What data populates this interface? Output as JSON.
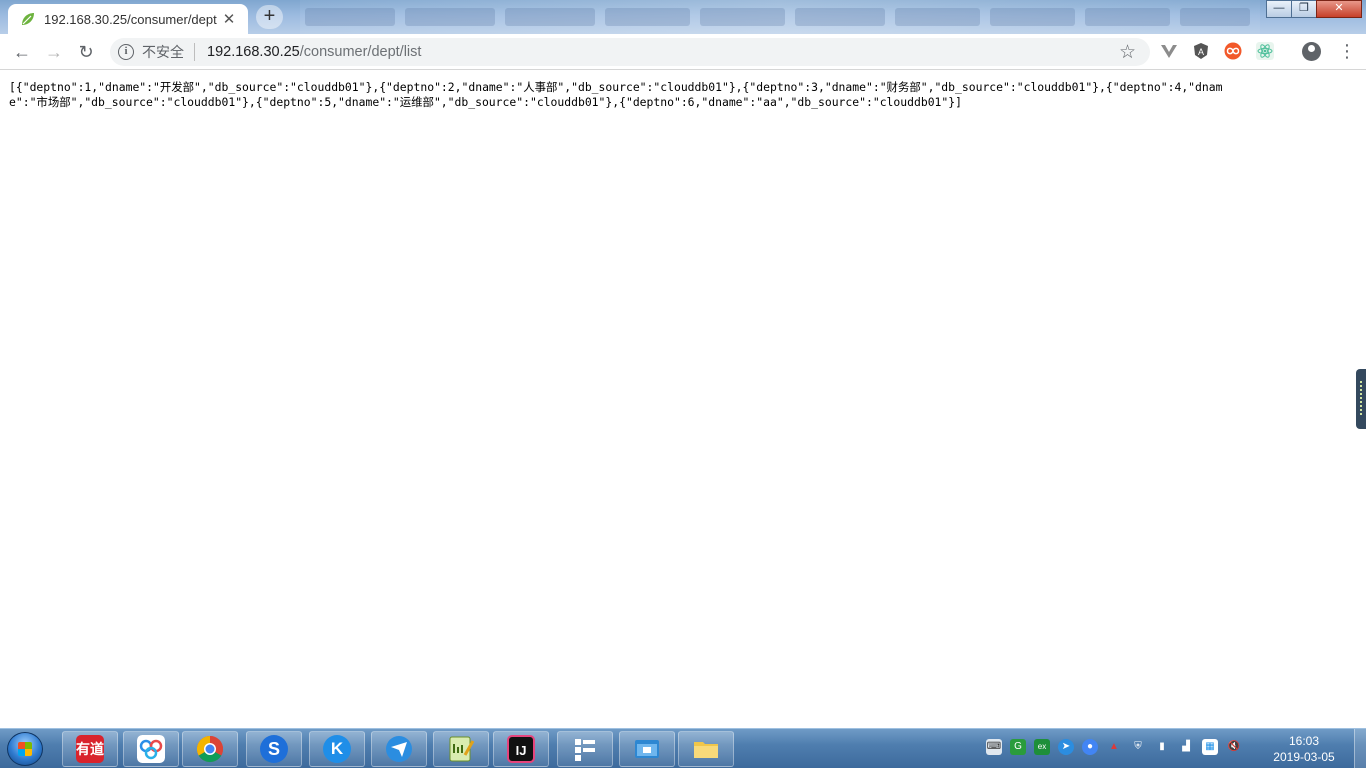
{
  "browser": {
    "tab": {
      "title": "192.168.30.25/consumer/dept",
      "close": "✕",
      "favicon": "spring-leaf-icon"
    },
    "new_tab": "+",
    "window_controls": {
      "minimize": "—",
      "maximize": "❐",
      "close": "✕"
    },
    "toolbar": {
      "back": "←",
      "forward": "→",
      "reload": "↻",
      "security_icon": "i",
      "security_label": "不安全",
      "url_host": "192.168.30.25",
      "url_path": "/consumer/dept/list",
      "bookmark": "☆",
      "menu": "⋮"
    },
    "extensions": [
      "vue-devtools-icon",
      "adblock-icon",
      "infinity-icon",
      "react-devtools-icon",
      "profile-icon"
    ]
  },
  "page": {
    "json_text": "[{\"deptno\":1,\"dname\":\"开发部\",\"db_source\":\"clouddb01\"},{\"deptno\":2,\"dname\":\"人事部\",\"db_source\":\"clouddb01\"},{\"deptno\":3,\"dname\":\"财务部\",\"db_source\":\"clouddb01\"},{\"deptno\":4,\"dname\":\"市场部\",\"db_source\":\"clouddb01\"},{\"deptno\":5,\"dname\":\"运维部\",\"db_source\":\"clouddb01\"},{\"deptno\":6,\"dname\":\"aa\",\"db_source\":\"clouddb01\"}]"
  },
  "taskbar": {
    "apps": [
      {
        "name": "youdao",
        "label": "有道",
        "color": "#d9232d"
      },
      {
        "name": "baidu-netdisk",
        "label": "",
        "color": "#ffffff"
      },
      {
        "name": "chrome",
        "label": "",
        "color": "#ffffff"
      },
      {
        "name": "sogou",
        "label": "S",
        "color": "#1e6fd9"
      },
      {
        "name": "kugou",
        "label": "K",
        "color": "#1f8ee8"
      },
      {
        "name": "feiq",
        "label": "",
        "color": "#2b8de0"
      },
      {
        "name": "notepad-plus",
        "label": "",
        "color": "#8fbf3c"
      },
      {
        "name": "intellij-idea",
        "label": "IJ",
        "color": "#111111"
      },
      {
        "name": "xshell",
        "label": "",
        "color": "#1b8fe8"
      },
      {
        "name": "file-manager",
        "label": "",
        "color": "#2d87d2"
      },
      {
        "name": "explorer",
        "label": "",
        "color": "#f0c64a"
      }
    ],
    "clock": {
      "time": "16:03",
      "date": "2019-03-05"
    }
  }
}
